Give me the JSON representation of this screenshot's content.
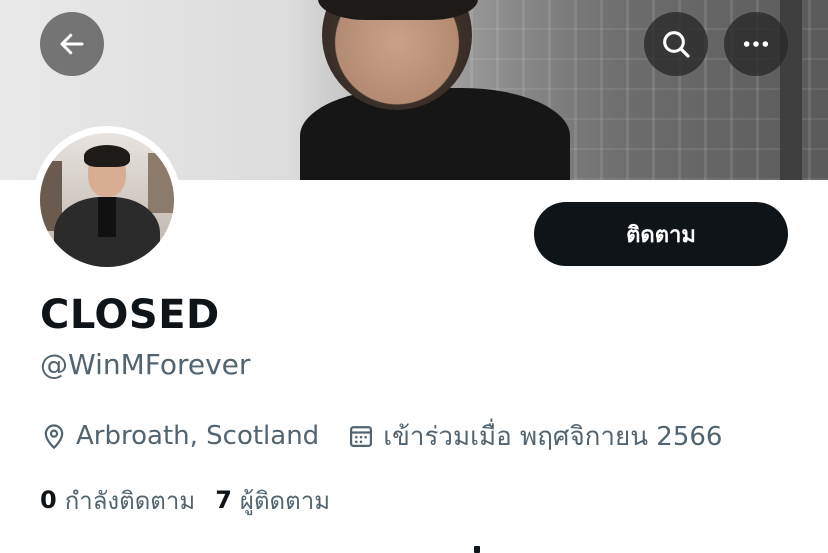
{
  "header": {
    "back_icon": "arrow-left-icon",
    "search_icon": "search-icon",
    "more_icon": "more-horizontal-icon"
  },
  "profile": {
    "display_name": "CLOSED",
    "handle": "@WinMForever",
    "follow_label": "ติดตาม",
    "location": "Arbroath, Scotland",
    "joined": "เข้าร่วมเมื่อ พฤศจิกายน 2566",
    "following_count": "0",
    "following_label": "กำลังติดตาม",
    "followers_count": "7",
    "followers_label": "ผู้ติดตาม"
  },
  "colors": {
    "primary_text": "#0f1419",
    "secondary_text": "#536471",
    "button_bg": "#0f1419"
  }
}
